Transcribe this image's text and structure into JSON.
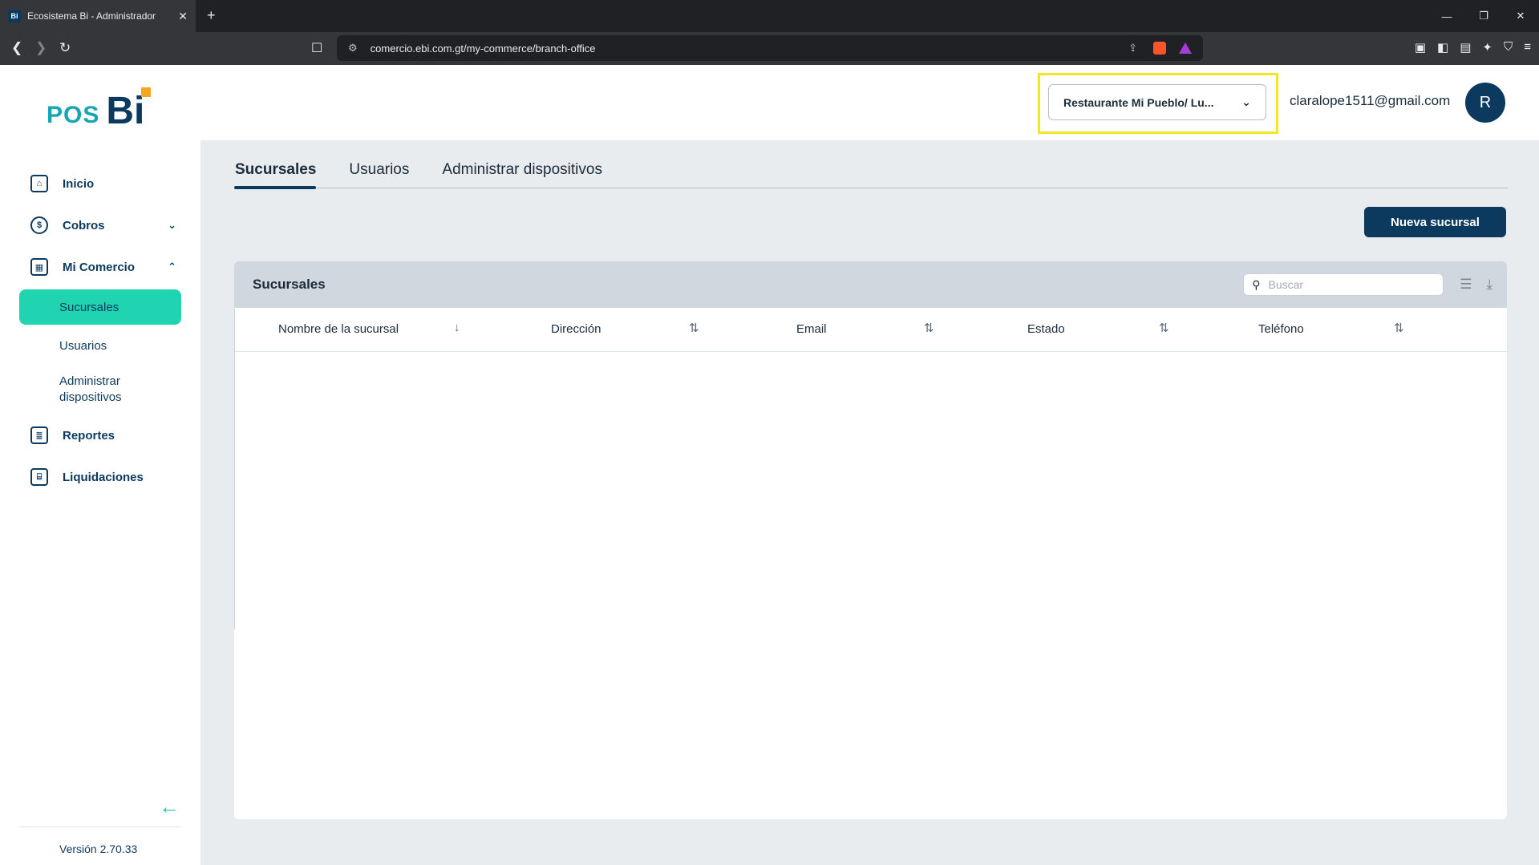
{
  "browser": {
    "tab_title": "Ecosistema Bi - Administrador",
    "favicon_text": "Bi",
    "url": "comercio.ebi.com.gt/my-commerce/branch-office"
  },
  "logo": {
    "pos": "POS",
    "bi": "Bi"
  },
  "sidebar": {
    "items": [
      {
        "label": "Inicio",
        "icon": "home-icon"
      },
      {
        "label": "Cobros",
        "icon": "money-icon",
        "expanded": false
      },
      {
        "label": "Mi Comercio",
        "icon": "store-icon",
        "expanded": true
      },
      {
        "label": "Reportes",
        "icon": "report-icon"
      },
      {
        "label": "Liquidaciones",
        "icon": "bank-icon"
      }
    ],
    "subitems": [
      "Sucursales",
      "Usuarios",
      "Administrar dispositivos"
    ],
    "active_subitem": "Sucursales",
    "version": "Versión 2.70.33"
  },
  "header": {
    "branch_selector": "Restaurante Mi Pueblo/ Lu...",
    "email": "claralope1511@gmail.com",
    "avatar_initial": "R"
  },
  "tabs": [
    "Sucursales",
    "Usuarios",
    "Administrar dispositivos"
  ],
  "active_tab": "Sucursales",
  "new_branch_button": "Nueva sucursal",
  "table": {
    "title": "Sucursales",
    "search_placeholder": "Buscar",
    "columns": [
      "Nombre de la sucursal",
      "Dirección",
      "Email",
      "Estado",
      "Teléfono"
    ],
    "rows": []
  },
  "colors": {
    "primary": "#0b3a5e",
    "accent": "#20d3b1",
    "highlight": "#f3e623"
  }
}
